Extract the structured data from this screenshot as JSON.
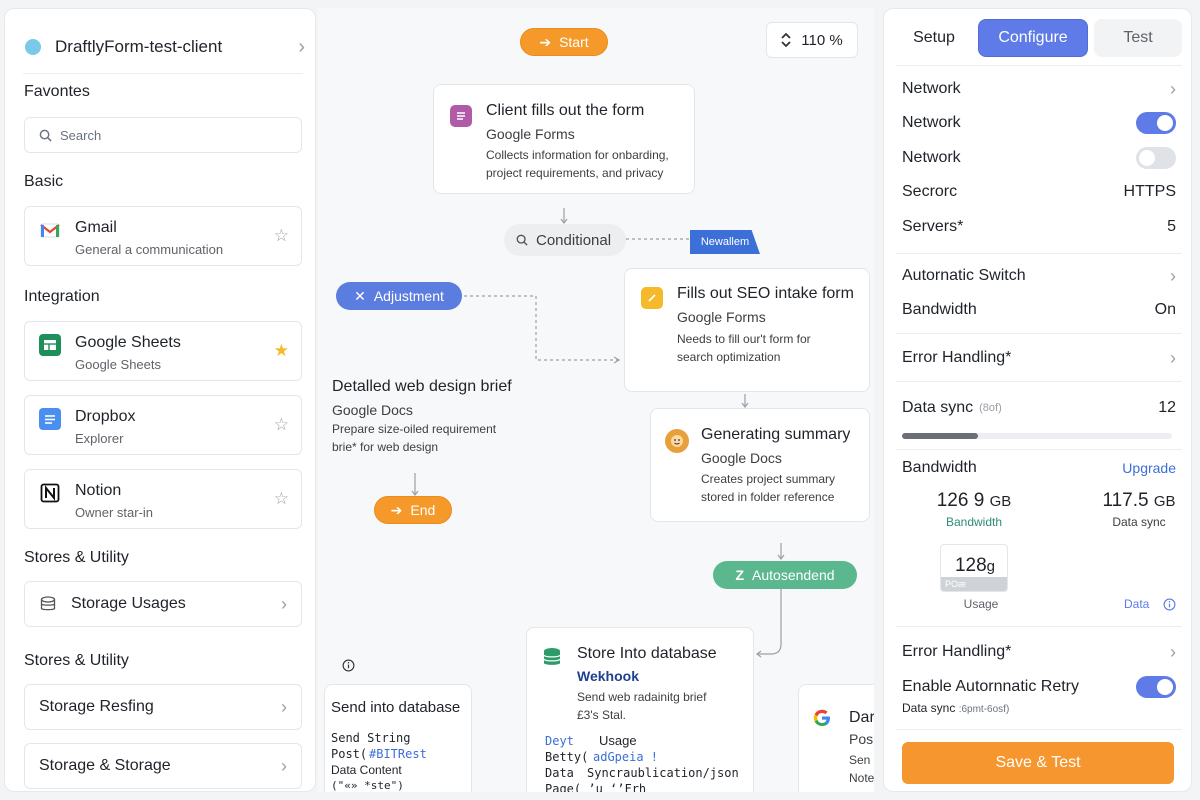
{
  "sidebar": {
    "workspace_name": "DraftlyForm-test-client",
    "section_favorites": "Favontes",
    "search_placeholder": "Search",
    "section_basic": "Basic",
    "gmail": {
      "title": "Gmail",
      "subtitle": "General a communication"
    },
    "section_integration": "Integration",
    "sheets": {
      "title": "Google Sheets",
      "subtitle": "Google Sheets"
    },
    "dropbox": {
      "title": "Dropbox",
      "subtitle": "Explorer"
    },
    "notion": {
      "title": "Notion",
      "subtitle": "Owner star-in"
    },
    "section_stores_1": "Stores & Utility",
    "storage_usages": "Storage Usages",
    "section_stores_2": "Stores & Utility",
    "storage_resting": "Storage Resfing",
    "storage_storage": "Storage & Storage"
  },
  "canvas": {
    "start_label": "Start",
    "zoom_label": "110 %",
    "node_client": {
      "title": "Client fills out the form",
      "source": "Google Forms",
      "desc1": "Collects information for onbarding,",
      "desc2": "project requirements, and privacy"
    },
    "conditional_label": "Conditional",
    "new_tag": "Newallem",
    "adjustment_label": "Adjustment",
    "node_seo": {
      "title": "Fills out SEO intake form",
      "source": "Google Forms",
      "desc1": "Needs to fill our't form for",
      "desc2": "search optimization"
    },
    "brief": {
      "title": "Detalled web design brief",
      "source": "Google Docs",
      "desc1": "Prepare size-oiled requirement",
      "desc2": "brie* for web design"
    },
    "end_label": "End",
    "node_summary": {
      "title": "Generating summary",
      "source": "Google Docs",
      "desc1": "Creates project summary",
      "desc2": "stored in folder reference"
    },
    "autosend_label": "Autosendend",
    "node_store": {
      "title": "Store Into database",
      "source": "Wekhook",
      "desc1": "Send web radainitg brief",
      "desc2": "£3's Stal.",
      "code1a": "Deyt",
      "code1b": "Usage",
      "code2a": "Betty(",
      "code2b": "adGpeia !",
      "code3a": "Data",
      "code3b": "Syncraublication/json",
      "code4": "Page( ’u ‘’Frh"
    },
    "send_db": {
      "title": "Send into database",
      "line1": "Send String",
      "line2a": "Post(",
      "line2b": "#BITRest",
      "line3": "Data Content",
      "line4": "(\"«» *ste\")"
    },
    "partial": {
      "title": "Dar",
      "line1": "Pos",
      "line2": "Sen",
      "line3": "Note"
    }
  },
  "panel": {
    "tab_setup": "Setup",
    "tab_configure": "Configure",
    "tab_test": "Test",
    "network_1": "Network",
    "network_2": "Network",
    "network_2_on": true,
    "network_3": "Network",
    "network_3_on": false,
    "secroc_label": "Secrorc",
    "secroc_value": "HTTPS",
    "servers_label": "Servers*",
    "servers_value": "5",
    "auto_switch": "Autornatic Switch",
    "bandwidth_label": "Bandwidth",
    "bandwidth_value": "On",
    "error_1": "Error Handling*",
    "data_sync_label": "Data sync",
    "data_sync_hint": "(8of)",
    "data_sync_value": "12",
    "data_sync_progress": 0.28,
    "bandwidth2_label": "Bandwidth",
    "upgrade_link": "Upgrade",
    "stat1_value": "126 9",
    "stat1_unit": "GB",
    "stat1_label": "Bandwidth",
    "stat2_value": "117.5",
    "stat2_unit": "GB",
    "stat2_label": "Data sync",
    "stat3_value": "128",
    "stat3_unit": "g",
    "stat3_tag": "POæ",
    "stat3_label": "Usage",
    "data_link": "Data",
    "error_2": "Error Handling*",
    "retry_label": "Enable Autornnatic Retry",
    "retry_on": true,
    "retry_sub": "Data sync",
    "retry_sub_hint": ":6pmt-6osf)",
    "save_label": "Save & Test"
  },
  "colors": {
    "accent_blue": "#5e7be8",
    "orange": "#f59a2a",
    "green": "#5bb88e",
    "star_yellow": "#f5b92a"
  }
}
